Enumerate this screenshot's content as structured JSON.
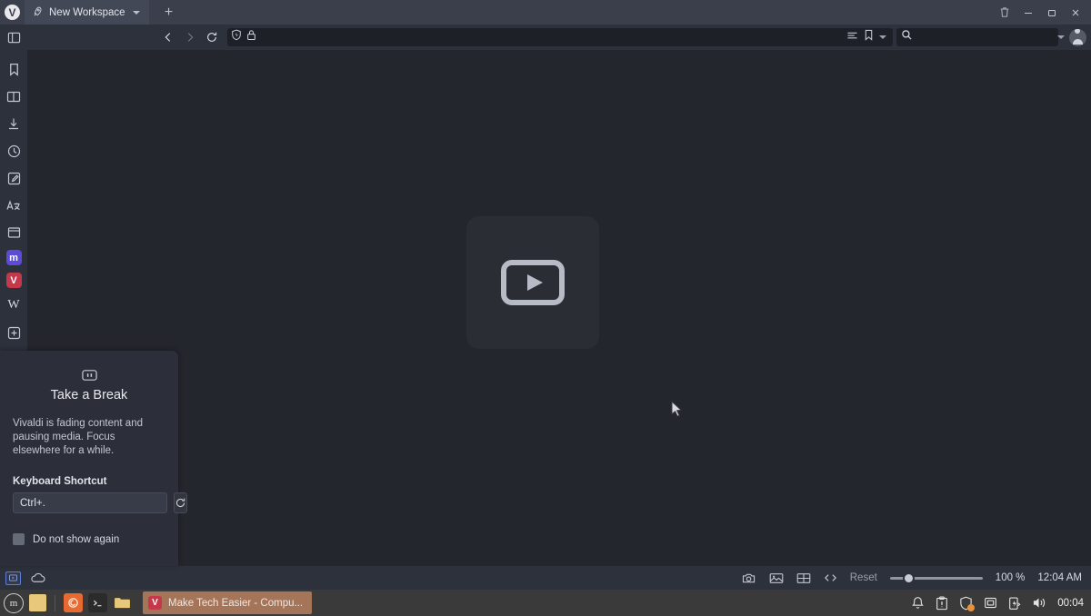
{
  "app": {
    "name": "Vivaldi",
    "logo_glyph": "V"
  },
  "titlebar": {
    "workspace_label": "New Workspace",
    "workspace_icon": "rocket-icon",
    "new_tab_label": "+",
    "window_buttons": [
      "trash-icon",
      "minimize-icon",
      "maximize-icon",
      "close-icon"
    ]
  },
  "navbar": {
    "panel_toggle_icon": "sidebar-panel-icon",
    "back_icon": "chevron-left-icon",
    "forward_icon": "chevron-right-icon",
    "reload_icon": "reload-icon",
    "shield_icon": "shield-icon",
    "lock_icon": "padlock-icon",
    "address_value": "",
    "address_placeholder": "",
    "reader_icon": "reader-mode-icon",
    "bookmark_icon": "bookmark-icon",
    "dropdown_icon": "chevron-down-icon",
    "search_value": "",
    "search_placeholder": "",
    "search_icon": "search-icon",
    "avatar_icon": "user-avatar-icon"
  },
  "panelbar": {
    "items": [
      {
        "name": "bookmarks",
        "icon": "bookmark-icon",
        "label": "Bookmarks"
      },
      {
        "name": "reading-list",
        "icon": "book-icon",
        "label": "Reading List"
      },
      {
        "name": "downloads",
        "icon": "download-icon",
        "label": "Downloads"
      },
      {
        "name": "history",
        "icon": "clock-icon",
        "label": "History"
      },
      {
        "name": "notes",
        "icon": "note-edit-icon",
        "label": "Notes"
      },
      {
        "name": "translate",
        "icon": "translate-icon",
        "label": "Translate"
      },
      {
        "name": "window",
        "icon": "window-icon",
        "label": "Window"
      },
      {
        "name": "mastodon",
        "icon": "mastodon-icon",
        "label": "m",
        "color": "#5b4bd6"
      },
      {
        "name": "vivaldi-web",
        "icon": "vivaldi-icon",
        "label": "V",
        "color": "#c4384a"
      },
      {
        "name": "wikipedia",
        "icon": "wikipedia-icon",
        "label": "W"
      },
      {
        "name": "add-panel",
        "icon": "plus-box-icon",
        "label": "Add Web Panel"
      }
    ]
  },
  "content": {
    "video_placeholder_icon": "video-play-icon",
    "background_color": "#24262d"
  },
  "break_panel": {
    "icon": "pause-icon",
    "title": "Take a Break",
    "description": "Vivaldi is fading content and pausing media. Focus elsewhere for a while.",
    "shortcut_label": "Keyboard Shortcut",
    "shortcut_value": "Ctrl+.",
    "shortcut_placeholder": "Ctrl+.",
    "reset_icon": "reset-icon",
    "checkbox_label": "Do not show again",
    "checkbox_checked": false
  },
  "statusbar": {
    "video_popout_icon": "video-popout-icon",
    "cloud_icon": "cloud-icon",
    "capture_icon": "camera-icon",
    "image_icon": "image-icon",
    "tiling_icon": "tiling-icon",
    "devtools_icon": "code-icon",
    "zoom_reset_label": "Reset",
    "zoom_percent": "100 %",
    "zoom_value": 100,
    "clock": "12:04 AM"
  },
  "taskbar": {
    "menu_icon": "linux-mint-menu-icon",
    "menu_glyph": "m",
    "quick_items": [
      {
        "name": "show-desktop",
        "icon": "desktop-square-icon",
        "color": "#e8c87a"
      },
      {
        "name": "firefox",
        "icon": "firefox-icon",
        "color": "#e86a32"
      },
      {
        "name": "terminal",
        "icon": "terminal-icon",
        "color": "#2b2b2b"
      },
      {
        "name": "files",
        "icon": "folder-icon",
        "color": "#e8c87a"
      }
    ],
    "window_title": "Make Tech Easier - Compu...",
    "window_icon": "vivaldi-icon",
    "window_glyph": "V",
    "tray": [
      {
        "name": "notifications",
        "icon": "bell-icon"
      },
      {
        "name": "clipboard",
        "icon": "clipboard-alert-icon"
      },
      {
        "name": "firewall",
        "icon": "shield-icon",
        "badge": true
      },
      {
        "name": "network",
        "icon": "network-icon"
      },
      {
        "name": "power",
        "icon": "battery-bolt-icon"
      },
      {
        "name": "volume",
        "icon": "speaker-icon"
      }
    ],
    "tray_clock": "00:04"
  },
  "colors": {
    "titlebar": "#3b3f4c",
    "toolbar": "#2d313c",
    "content": "#24262d",
    "panel": "#2c2f3a",
    "taskbar": "#3a3a3a",
    "accent": "#c4384a",
    "task_active": "#a5755a"
  }
}
